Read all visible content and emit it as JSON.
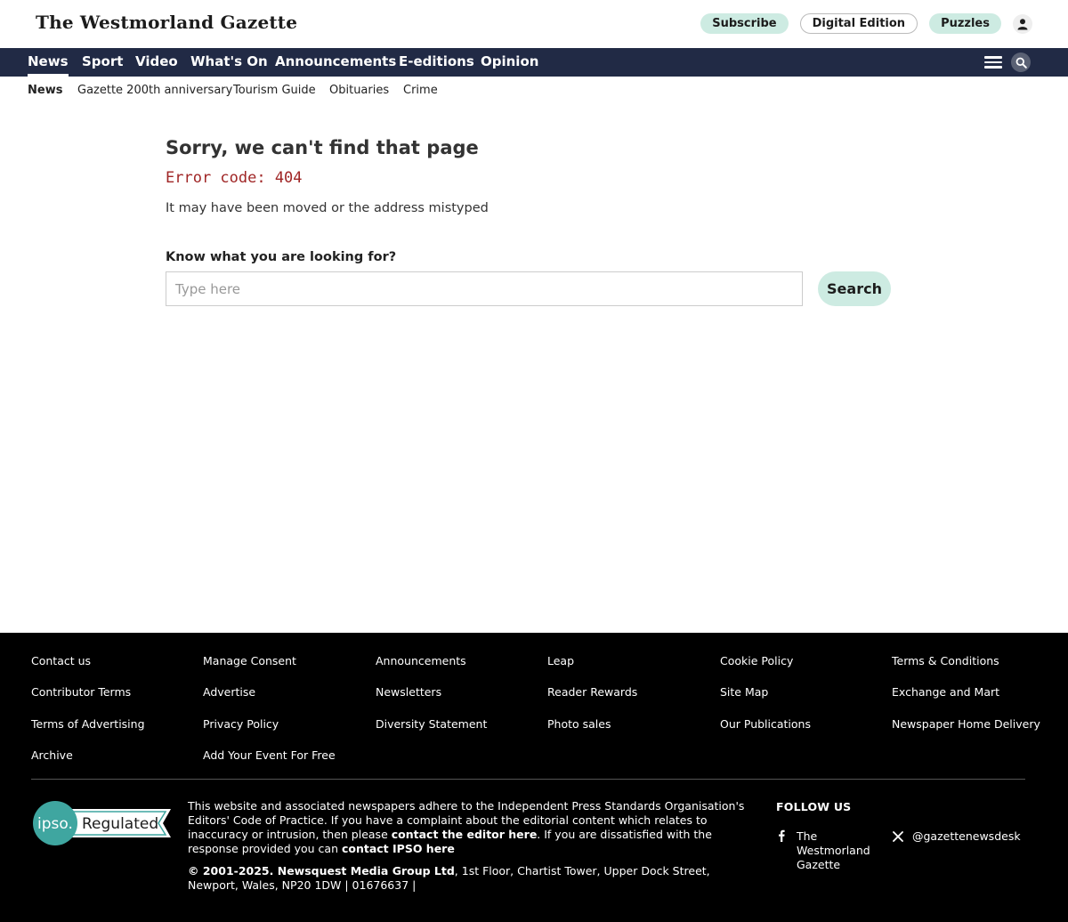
{
  "header": {
    "logo": "The Westmorland Gazette",
    "subscribe": "Subscribe",
    "digital_edition": "Digital Edition",
    "puzzles": "Puzzles"
  },
  "main_nav": {
    "items": [
      "News",
      "Sport",
      "Video",
      "What's On",
      "Announcements",
      "E-editions",
      "Opinion"
    ],
    "active": "News"
  },
  "sub_nav": {
    "items": [
      "News",
      "Gazette 200th anniversary",
      "Tourism Guide",
      "Obituaries",
      "Crime"
    ]
  },
  "error_page": {
    "title": "Sorry, we can't find that page",
    "error_code": "Error code: 404",
    "description": "It may have been moved or the address mistyped",
    "search_label": "Know what you are looking for?",
    "search_placeholder": "Type here",
    "search_button": "Search"
  },
  "footer": {
    "columns": [
      [
        "Contact us",
        "Contributor Terms",
        "Terms of Advertising",
        "Archive"
      ],
      [
        "Manage Consent",
        "Advertise",
        "Privacy Policy",
        "Add Your Event For Free"
      ],
      [
        "Announcements",
        "Newsletters",
        "Diversity Statement"
      ],
      [
        "Leap",
        "Reader Rewards",
        "Photo sales"
      ],
      [
        "Cookie Policy",
        "Site Map",
        "Our Publications"
      ],
      [
        "Terms & Conditions",
        "Exchange and Mart",
        "Newspaper Home Delivery"
      ]
    ],
    "ipso_badge": {
      "short": "ipso.",
      "label": "Regulated"
    },
    "legal": {
      "part1": "This website and associated newspapers adhere to the Independent Press Standards Organisation's Editors' Code of Practice. If you have a complaint about the editorial content which relates to inaccuracy or intrusion, then please ",
      "link1": "contact the editor here",
      "part2": ". If you are dissatisfied with the response provided you can ",
      "link2": "contact IPSO here"
    },
    "copyright": {
      "years": "© 2001-2025",
      "company": "Newsquest Media Group Ltd",
      "address": ", 1st Floor, Chartist Tower, Upper Dock Street, Newport, Wales, NP20 1DW | 01676637 |"
    },
    "follow_us": "FOLLOW US",
    "social": {
      "facebook": "The Westmorland Gazette",
      "x": "@gazettenewsdesk"
    }
  },
  "colors": {
    "nav_bg": "#212a45",
    "accent_mint": "#cdebe2",
    "error_red": "#a02626",
    "footer_bg": "#000000"
  },
  "icons": [
    "user-icon",
    "menu-icon",
    "search-icon",
    "facebook-icon",
    "x-icon"
  ]
}
